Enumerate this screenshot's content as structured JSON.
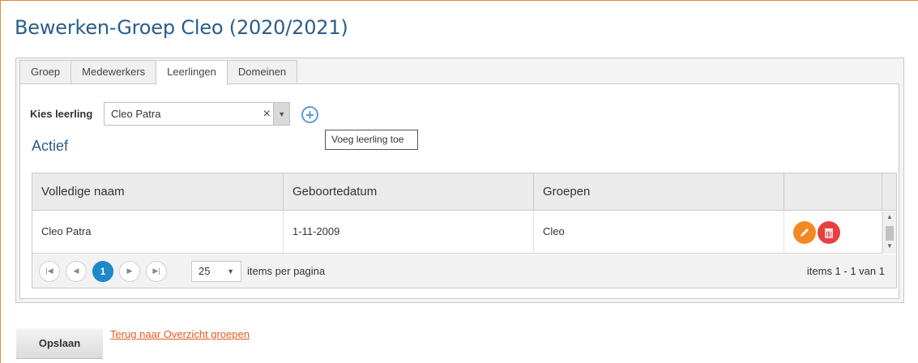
{
  "page": {
    "title": "Bewerken-Groep Cleo (2020/2021)"
  },
  "tabs": [
    {
      "label": "Groep",
      "active": false
    },
    {
      "label": "Medewerkers",
      "active": false
    },
    {
      "label": "Leerlingen",
      "active": true
    },
    {
      "label": "Domeinen",
      "active": false
    }
  ],
  "picker": {
    "label": "Kies leerling",
    "value": "Cleo Patra",
    "clear_glyph": "×",
    "arrow_glyph": "▼",
    "add_glyph": "+",
    "tooltip": "Voeg leerling toe"
  },
  "section": {
    "title": "Actief"
  },
  "grid": {
    "columns": [
      "Volledige naam",
      "Geboortedatum",
      "Groepen",
      ""
    ],
    "rows": [
      {
        "name": "Cleo Patra",
        "dob": "1-11-2009",
        "groups": "Cleo"
      }
    ]
  },
  "pager": {
    "current_page": "1",
    "page_size": "25",
    "per_page_label": "items per pagina",
    "info": "items 1 - 1 van 1"
  },
  "footer": {
    "save_label": "Opslaan",
    "back_link": "Terug naar Overzicht groepen"
  },
  "colors": {
    "title": "#2a5d8a",
    "accent_border": "#e8893a",
    "edit_icon": "#f28a22",
    "delete_icon": "#e84040",
    "pager_active": "#1e88c8",
    "link": "#e35a1e"
  },
  "icons": [
    "add-circle-icon",
    "clear-icon",
    "dropdown-arrow-icon",
    "edit-icon",
    "delete-icon",
    "first-page-icon",
    "prev-page-icon",
    "next-page-icon",
    "last-page-icon"
  ]
}
